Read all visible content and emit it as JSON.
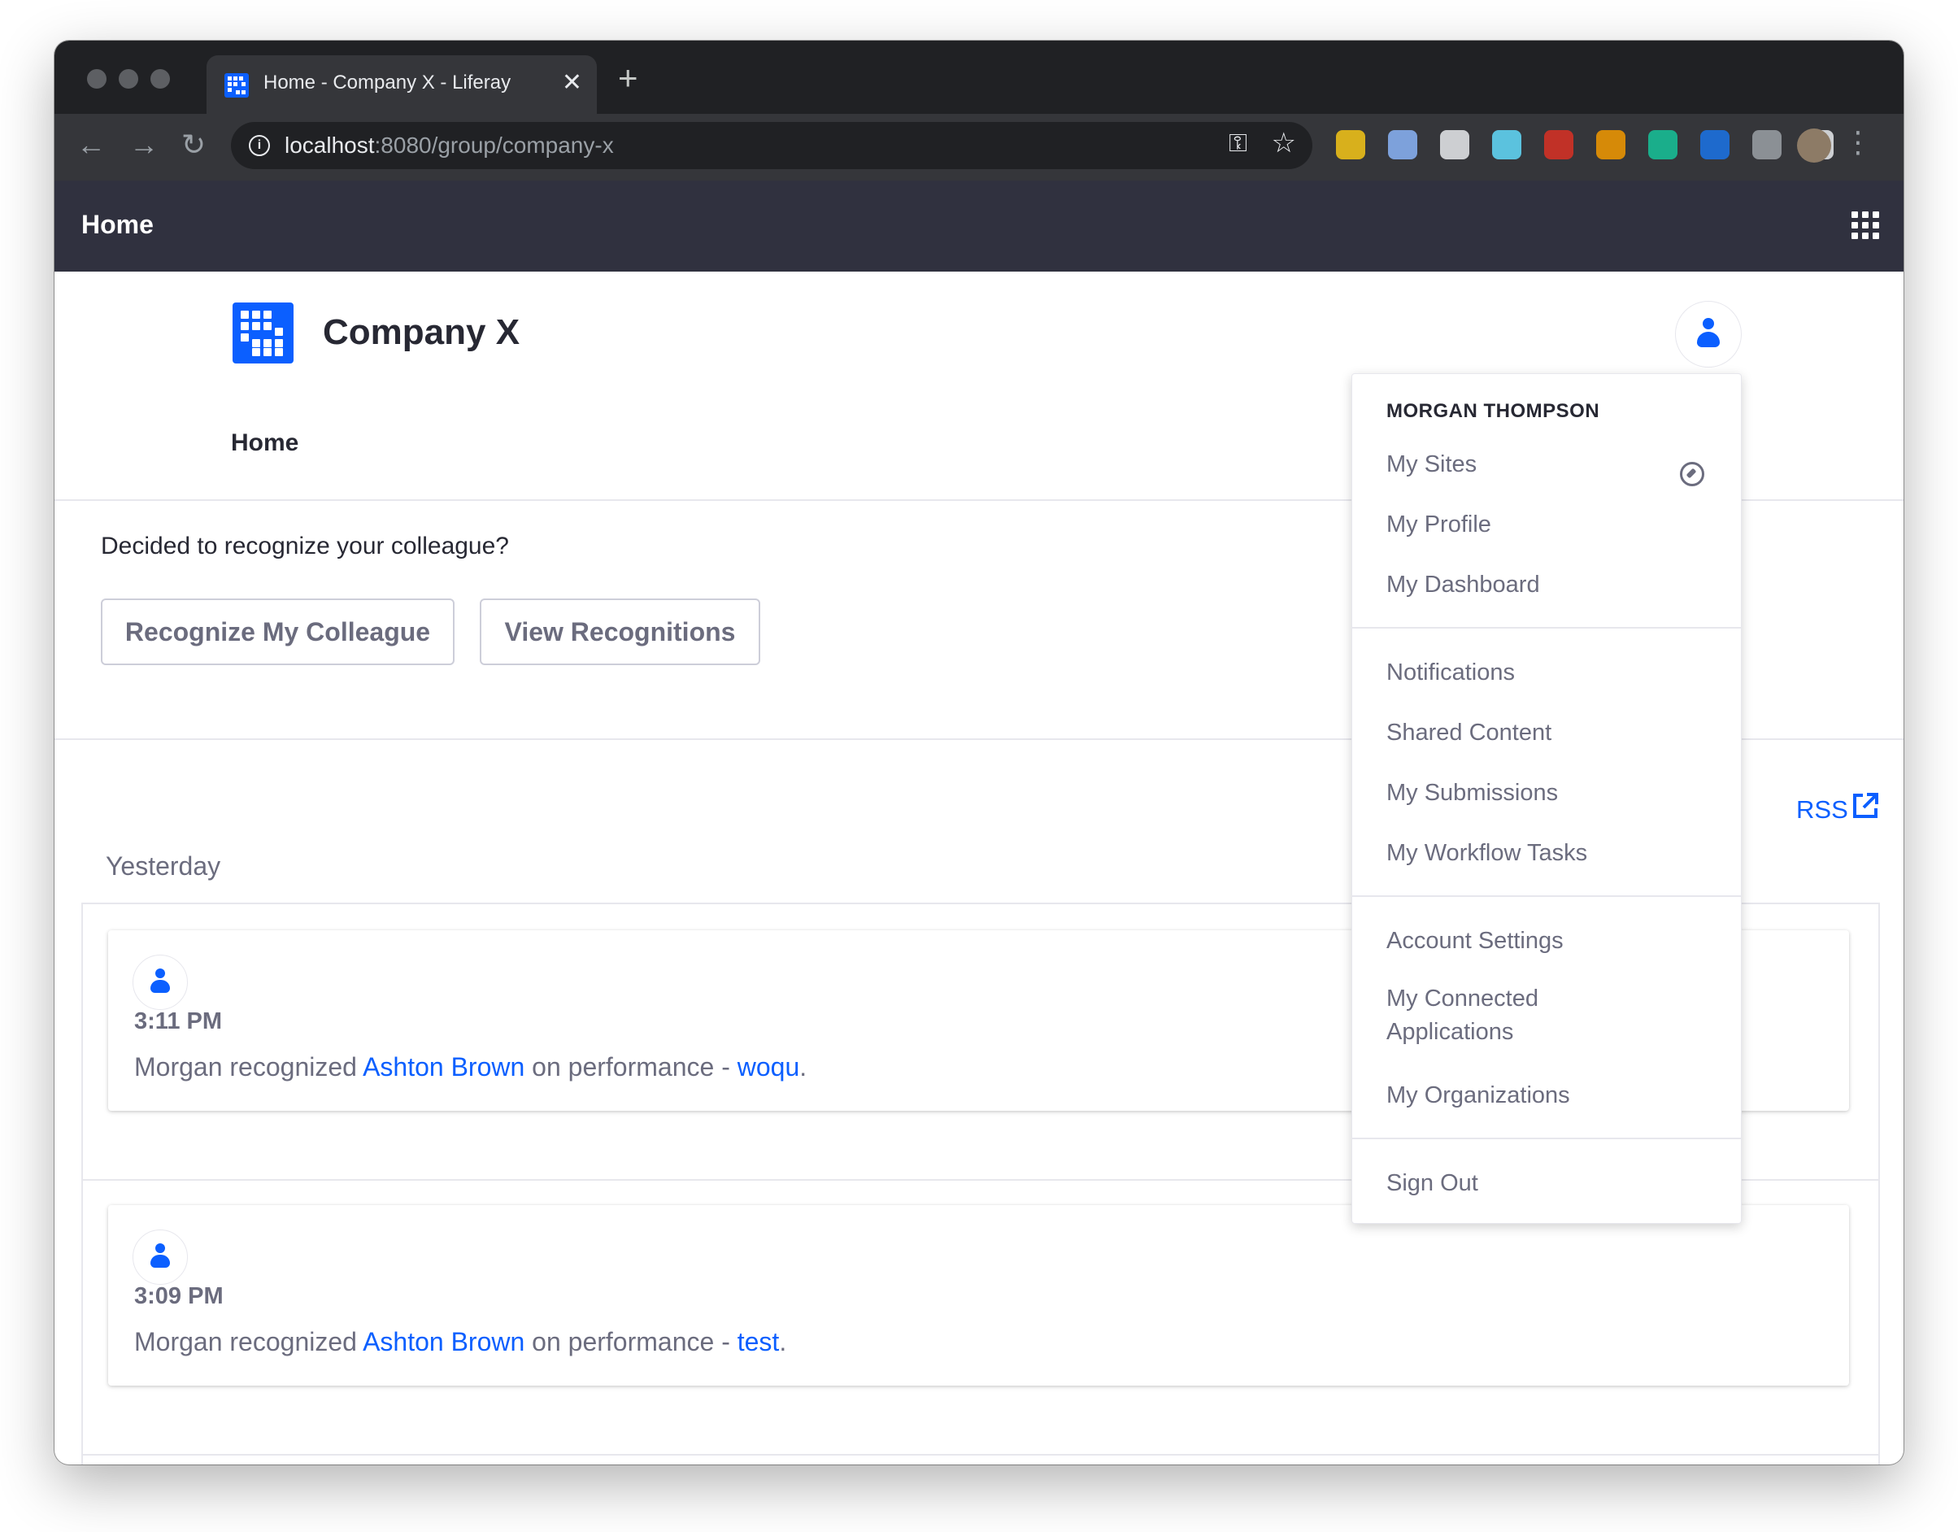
{
  "browser": {
    "tab_title": "Home - Company X - Liferay",
    "tab_close": "✕",
    "new_tab": "+",
    "url_host": "localhost",
    "url_path": ":8080/group/company-x",
    "back": "←",
    "forward": "→",
    "reload": "↻",
    "key_icon": "⚿",
    "star_icon": "☆",
    "menu": "⋮",
    "extensions": [
      {
        "name": "extension-key-icon",
        "color": "#f5c518"
      },
      {
        "name": "extension-ring-icon",
        "color": "#8ab4f8"
      },
      {
        "name": "extension-zero-icon",
        "color": "#e8eaed"
      },
      {
        "name": "extension-react-icon",
        "color": "#61dafb"
      },
      {
        "name": "extension-cors-icon",
        "color": "#d93025"
      },
      {
        "name": "extension-infinity-icon",
        "color": "#f29900"
      },
      {
        "name": "extension-grammarly-icon",
        "color": "#15c39a"
      },
      {
        "name": "extension-calendar-icon",
        "color": "#1a73e8"
      },
      {
        "name": "extension-cube-icon",
        "color": "#9aa0a6"
      },
      {
        "name": "extension-puzzle-icon",
        "color": "#e8eaed"
      }
    ]
  },
  "controlbar": {
    "title": "Home"
  },
  "site": {
    "name": "Company X",
    "nav_home": "Home"
  },
  "recognition": {
    "prompt": "Decided to recognize your colleague?",
    "recognize_button": "Recognize My Colleague",
    "view_button": "View Recognitions"
  },
  "activities": {
    "rss": "RSS",
    "group_label": "Yesterday",
    "items": [
      {
        "time": "3:11 PM",
        "actor": "Morgan recognized ",
        "person": "Ashton Brown",
        "middle": " on performance - ",
        "topic": "woqu",
        "end": "."
      },
      {
        "time": "3:09 PM",
        "actor": "Morgan recognized ",
        "person": "Ashton Brown",
        "middle": " on performance - ",
        "topic": "test",
        "end": "."
      }
    ]
  },
  "user_menu": {
    "header": "MORGAN THOMPSON",
    "items": [
      "My Sites",
      "My Profile",
      "My Dashboard",
      "Notifications",
      "Shared Content",
      "My Submissions",
      "My Workflow Tasks",
      "Account Settings",
      "My Connected Applications",
      "My Organizations",
      "Sign Out"
    ]
  },
  "colors": {
    "accent": "#0b5fff",
    "control_bar": "#30313f",
    "muted_text": "#6b6c7e"
  }
}
